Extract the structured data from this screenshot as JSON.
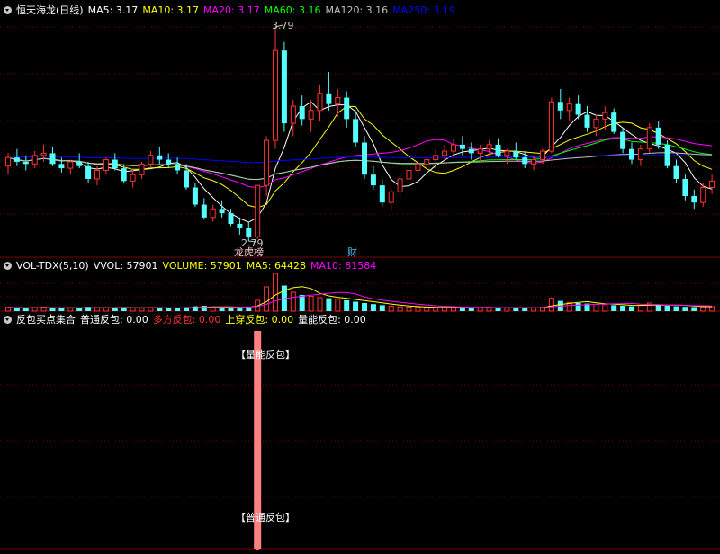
{
  "colors": {
    "up": "#ff3232",
    "down": "#54ffff",
    "ma5": "#ffffff",
    "ma10": "#ffff00",
    "ma20": "#ff00ff",
    "ma60": "#00ff00",
    "ma120": "#c0c0c0",
    "ma250": "#0000ff",
    "grid": "#7a0000",
    "signal_bar": "#ff8080"
  },
  "price_panel": {
    "title": "恒天海龙(日线)",
    "indicators": [
      {
        "label": "MA5: 3.17",
        "color": "#ffffff"
      },
      {
        "label": "MA10: 3.17",
        "color": "#ffff00"
      },
      {
        "label": "MA20: 3.17",
        "color": "#ff00ff"
      },
      {
        "label": "MA60: 3.16",
        "color": "#00ff00"
      },
      {
        "label": "MA120: 3.16",
        "color": "#c0c0c0"
      },
      {
        "label": "MA250: 3.19",
        "color": "#0000ff"
      }
    ],
    "high_label": "3.79",
    "low_label": "2.79",
    "markers": [
      {
        "text": "龙虎榜",
        "color": "#ffc8c8"
      },
      {
        "text": "财",
        "color": "#54c8ff"
      }
    ]
  },
  "volume_panel": {
    "title": "VOL-TDX(5,10)",
    "indicators": [
      {
        "label": "VVOL: 57901",
        "color": "#ffffff"
      },
      {
        "label": "VOLUME: 57901",
        "color": "#ffff00"
      },
      {
        "label": "MA5: 64428",
        "color": "#ffff00"
      },
      {
        "label": "MA10: 81584",
        "color": "#ff00ff"
      }
    ]
  },
  "signal_panel": {
    "title": "反包买点集合",
    "indicators": [
      {
        "label": "普通反包: 0.00",
        "color": "#ffffff"
      },
      {
        "label": "多方反包: 0.00",
        "color": "#ff3232"
      },
      {
        "label": "上穿反包: 0.00",
        "color": "#ffff00"
      },
      {
        "label": "量能反包: 0.00",
        "color": "#ffffff"
      }
    ],
    "annotations": [
      {
        "text": "【量能反包】"
      },
      {
        "text": "【普通反包】"
      }
    ]
  },
  "chart_data": {
    "type": "candlestick",
    "price_range": [
      2.79,
      3.79
    ],
    "candles": [
      [
        3.14,
        3.2,
        3.1,
        3.18
      ],
      [
        3.18,
        3.22,
        3.14,
        3.16
      ],
      [
        3.16,
        3.19,
        3.12,
        3.15
      ],
      [
        3.15,
        3.21,
        3.13,
        3.19
      ],
      [
        3.19,
        3.24,
        3.16,
        3.2
      ],
      [
        3.2,
        3.23,
        3.14,
        3.15
      ],
      [
        3.15,
        3.18,
        3.11,
        3.13
      ],
      [
        3.13,
        3.17,
        3.1,
        3.16
      ],
      [
        3.16,
        3.2,
        3.13,
        3.14
      ],
      [
        3.14,
        3.16,
        3.06,
        3.08
      ],
      [
        3.08,
        3.14,
        3.05,
        3.12
      ],
      [
        3.12,
        3.18,
        3.1,
        3.17
      ],
      [
        3.17,
        3.2,
        3.12,
        3.13
      ],
      [
        3.13,
        3.15,
        3.06,
        3.07
      ],
      [
        3.07,
        3.12,
        3.04,
        3.1
      ],
      [
        3.1,
        3.16,
        3.08,
        3.15
      ],
      [
        3.15,
        3.21,
        3.13,
        3.19
      ],
      [
        3.19,
        3.23,
        3.15,
        3.17
      ],
      [
        3.17,
        3.2,
        3.13,
        3.15
      ],
      [
        3.15,
        3.18,
        3.1,
        3.12
      ],
      [
        3.12,
        3.15,
        3.03,
        3.04
      ],
      [
        3.04,
        3.06,
        2.95,
        2.96
      ],
      [
        2.96,
        2.99,
        2.89,
        2.9
      ],
      [
        2.9,
        2.96,
        2.88,
        2.94
      ],
      [
        2.94,
        2.98,
        2.9,
        2.92
      ],
      [
        2.92,
        2.94,
        2.86,
        2.87
      ],
      [
        2.87,
        2.9,
        2.82,
        2.85
      ],
      [
        2.85,
        2.88,
        2.79,
        2.81
      ],
      [
        2.81,
        3.05,
        2.8,
        3.05
      ],
      [
        3.05,
        3.28,
        3.0,
        3.26
      ],
      [
        3.26,
        3.79,
        3.22,
        3.68
      ],
      [
        3.68,
        3.72,
        3.3,
        3.34
      ],
      [
        3.34,
        3.45,
        3.28,
        3.42
      ],
      [
        3.42,
        3.47,
        3.33,
        3.36
      ],
      [
        3.36,
        3.45,
        3.3,
        3.4
      ],
      [
        3.4,
        3.52,
        3.35,
        3.48
      ],
      [
        3.48,
        3.58,
        3.4,
        3.43
      ],
      [
        3.43,
        3.5,
        3.37,
        3.46
      ],
      [
        3.46,
        3.49,
        3.32,
        3.36
      ],
      [
        3.36,
        3.4,
        3.23,
        3.25
      ],
      [
        3.25,
        3.28,
        3.08,
        3.1
      ],
      [
        3.1,
        3.14,
        3.03,
        3.05
      ],
      [
        3.05,
        3.08,
        2.95,
        2.97
      ],
      [
        2.97,
        3.04,
        2.93,
        3.02
      ],
      [
        3.02,
        3.1,
        2.99,
        3.08
      ],
      [
        3.08,
        3.14,
        3.05,
        3.12
      ],
      [
        3.12,
        3.16,
        3.08,
        3.15
      ],
      [
        3.15,
        3.19,
        3.12,
        3.17
      ],
      [
        3.17,
        3.22,
        3.13,
        3.19
      ],
      [
        3.19,
        3.24,
        3.15,
        3.21
      ],
      [
        3.21,
        3.27,
        3.18,
        3.24
      ],
      [
        3.24,
        3.28,
        3.19,
        3.22
      ],
      [
        3.22,
        3.25,
        3.17,
        3.2
      ],
      [
        3.2,
        3.24,
        3.16,
        3.22
      ],
      [
        3.22,
        3.26,
        3.19,
        3.24
      ],
      [
        3.24,
        3.27,
        3.18,
        3.19
      ],
      [
        3.19,
        3.22,
        3.15,
        3.21
      ],
      [
        3.21,
        3.25,
        3.17,
        3.18
      ],
      [
        3.18,
        3.21,
        3.13,
        3.15
      ],
      [
        3.15,
        3.19,
        3.12,
        3.17
      ],
      [
        3.17,
        3.22,
        3.15,
        3.21
      ],
      [
        3.21,
        3.46,
        3.2,
        3.44
      ],
      [
        3.44,
        3.5,
        3.36,
        3.4
      ],
      [
        3.4,
        3.46,
        3.35,
        3.43
      ],
      [
        3.43,
        3.47,
        3.36,
        3.38
      ],
      [
        3.38,
        3.42,
        3.3,
        3.32
      ],
      [
        3.32,
        3.38,
        3.28,
        3.36
      ],
      [
        3.36,
        3.42,
        3.31,
        3.39
      ],
      [
        3.39,
        3.41,
        3.29,
        3.3
      ],
      [
        3.3,
        3.32,
        3.2,
        3.22
      ],
      [
        3.22,
        3.25,
        3.15,
        3.17
      ],
      [
        3.17,
        3.24,
        3.14,
        3.22
      ],
      [
        3.22,
        3.34,
        3.2,
        3.32
      ],
      [
        3.32,
        3.35,
        3.22,
        3.24
      ],
      [
        3.24,
        3.26,
        3.13,
        3.14
      ],
      [
        3.14,
        3.17,
        3.06,
        3.08
      ],
      [
        3.08,
        3.1,
        2.98,
        3.0
      ],
      [
        3.0,
        3.03,
        2.94,
        2.97
      ],
      [
        2.97,
        3.06,
        2.95,
        3.04
      ],
      [
        3.04,
        3.1,
        3.01,
        3.07
      ]
    ],
    "volume": [
      14,
      12,
      10,
      13,
      15,
      12,
      10,
      11,
      12,
      16,
      13,
      12,
      11,
      15,
      12,
      11,
      13,
      12,
      10,
      11,
      15,
      18,
      20,
      14,
      13,
      15,
      12,
      17,
      40,
      90,
      140,
      95,
      70,
      60,
      55,
      50,
      48,
      44,
      40,
      35,
      30,
      26,
      22,
      18,
      16,
      15,
      14,
      13,
      12,
      14,
      16,
      13,
      12,
      13,
      14,
      12,
      11,
      13,
      12,
      12,
      14,
      48,
      38,
      32,
      30,
      28,
      25,
      24,
      22,
      20,
      18,
      22,
      30,
      24,
      20,
      18,
      16,
      15,
      16,
      17
    ],
    "signals": [
      {
        "index": 28,
        "value": 1
      }
    ]
  }
}
